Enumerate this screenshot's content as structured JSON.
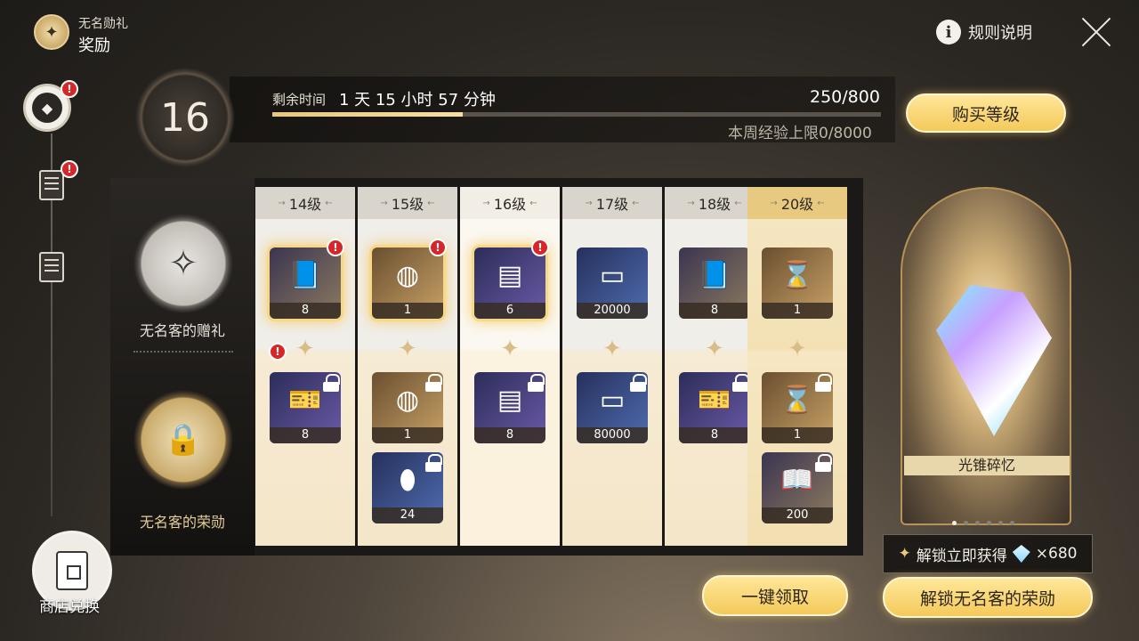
{
  "header": {
    "subtitle": "无名勋礼",
    "title": "奖励"
  },
  "top_right": {
    "rules_label": "规则说明"
  },
  "rail": {
    "shop_label": "商店兑换",
    "alert_glyph": "!"
  },
  "progress": {
    "level": "16",
    "time_label": "剩余时间",
    "time_value": "1 天 15 小时 57 分钟",
    "exp": "250/800",
    "exp_fraction": 0.3125,
    "weekly_cap": "本周经验上限0/8000",
    "buy_level_label": "购买等级"
  },
  "tracks": {
    "free_label": "无名客的赠礼",
    "paid_label": "无名客的荣勋"
  },
  "columns": [
    {
      "label": "14级",
      "free": [
        {
          "qty": "8",
          "icon": "book-icon",
          "claimable": true
        }
      ],
      "paid": [
        {
          "qty": "8",
          "icon": "ticket-icon"
        }
      ]
    },
    {
      "label": "15级",
      "free": [
        {
          "qty": "1",
          "icon": "orb-icon",
          "claimable": true
        }
      ],
      "paid": [
        {
          "qty": "1",
          "icon": "orb-icon"
        },
        {
          "qty": "24",
          "icon": "flask-icon"
        }
      ]
    },
    {
      "label": "16级",
      "free": [
        {
          "qty": "6",
          "icon": "canister-icon",
          "claimable": true
        }
      ],
      "paid": [
        {
          "qty": "8",
          "icon": "canister-icon"
        }
      ]
    },
    {
      "label": "17级",
      "free": [
        {
          "qty": "20000",
          "icon": "credit-icon"
        }
      ],
      "paid": [
        {
          "qty": "80000",
          "icon": "credit-icon"
        }
      ]
    },
    {
      "label": "18级",
      "free": [
        {
          "qty": "8",
          "icon": "book-icon"
        }
      ],
      "paid": [
        {
          "qty": "8",
          "icon": "ticket-icon"
        }
      ]
    },
    {
      "label": "20级",
      "free": [
        {
          "qty": "1",
          "icon": "hourglass-icon"
        }
      ],
      "paid": [
        {
          "qty": "1",
          "icon": "hourglass-icon"
        },
        {
          "qty": "200",
          "icon": "tome-icon"
        }
      ]
    }
  ],
  "showcase": {
    "name": "光锥碎忆",
    "page_count": 6,
    "current_page": 1
  },
  "unlock_tip": {
    "text": "解锁立即获得",
    "amount": "×680"
  },
  "buttons": {
    "claim_all": "一键领取",
    "unlock": "解锁无名客的荣勋"
  }
}
